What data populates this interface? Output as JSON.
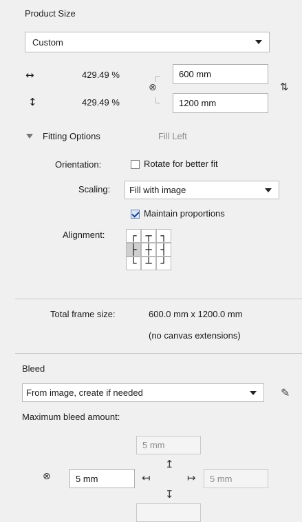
{
  "product_size": {
    "title": "Product Size",
    "preset_value": "Custom",
    "width_percent": "429.49 %",
    "height_percent": "429.49 %",
    "width_value": "600 mm",
    "height_value": "1200 mm",
    "icons": {
      "width_arrow": "↔",
      "height_arrow": "↕",
      "link": "⊗",
      "swap": "⇅"
    }
  },
  "fitting": {
    "header_label": "Fitting Options",
    "fill_status": "Fill Left",
    "orientation_label": "Orientation:",
    "orientation_checkbox_label": "Rotate for better fit",
    "orientation_checked": false,
    "scaling_label": "Scaling:",
    "scaling_value": "Fill with image",
    "maintain_label": "Maintain proportions",
    "maintain_checked": true,
    "alignment_label": "Alignment:",
    "alignment_grid": [
      "┌",
      "┬",
      "┐",
      "├",
      "┼",
      "┤",
      "└",
      "┴",
      "┘"
    ],
    "alignment_selected_index": 3
  },
  "frame": {
    "label": "Total frame size:",
    "value": "600.0 mm x 1200.0 mm",
    "note": "(no canvas extensions)"
  },
  "bleed": {
    "title": "Bleed",
    "mode_value": "From image, create if needed",
    "max_label": "Maximum bleed amount:",
    "top_value": "5 mm",
    "left_value": "5 mm",
    "right_value": "5 mm",
    "bottom_value": "",
    "icons": {
      "edit": "✎",
      "link": "⊗",
      "arrow_up": "↥",
      "arrow_down": "↧",
      "arrow_left": "↤",
      "arrow_right": "↦"
    }
  }
}
